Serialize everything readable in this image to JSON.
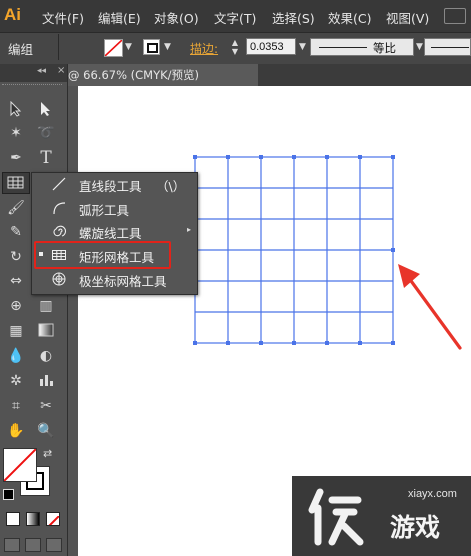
{
  "menubar": {
    "logo": "Ai",
    "items": [
      "文件(F)",
      "编辑(E)",
      "对象(O)",
      "文字(T)",
      "选择(S)",
      "效果(C)",
      "视图(V)"
    ]
  },
  "controlbar": {
    "selection_label": "编组",
    "stroke_label": "描边:",
    "stroke_value": "0.0353",
    "profile_label": "等比"
  },
  "document_tab": {
    "title": "@ 66.67% (CMYK/预览)"
  },
  "flyout": {
    "items": [
      {
        "label": "直线段工具",
        "shortcut": "（\\）",
        "icon": "line-segment-icon"
      },
      {
        "label": "弧形工具",
        "icon": "arc-icon"
      },
      {
        "label": "螺旋线工具",
        "icon": "spiral-icon"
      },
      {
        "label": "矩形网格工具",
        "icon": "rectangular-grid-icon",
        "active": true
      },
      {
        "label": "极坐标网格工具",
        "icon": "polar-grid-icon"
      }
    ]
  },
  "colors": {
    "highlight_border": "#e2231a",
    "arrow": "#e8342a",
    "grid_lines": "#4a73e8",
    "logo": "#f4a52b"
  },
  "watermark": {
    "domain": "xiayx.com",
    "brand": "游戏"
  }
}
